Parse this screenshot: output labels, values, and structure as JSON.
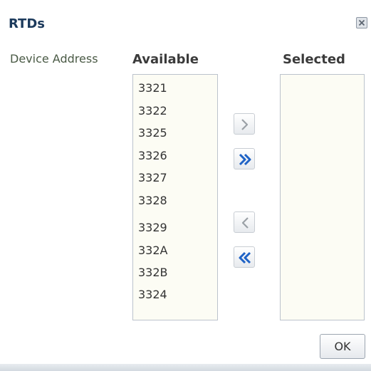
{
  "dialog": {
    "title": "RTDs",
    "close_icon": "close-icon",
    "field_label": "Device Address",
    "ok_label": "OK"
  },
  "available": {
    "header": "Available",
    "items": [
      "3321",
      "3322",
      "3325",
      "3326",
      "3327",
      "3328",
      "3329",
      "332A",
      "332B",
      "3324"
    ]
  },
  "selected": {
    "header": "Selected",
    "items": []
  },
  "shuttle": {
    "move_icon": "chevron-right-icon",
    "move_all_icon": "double-chevron-right-icon",
    "remove_icon": "chevron-left-icon",
    "remove_all_icon": "double-chevron-left-icon"
  },
  "colors": {
    "title": "#1c3a5c",
    "active_arrow": "#1f63c6",
    "disabled_arrow": "#9aa0a6",
    "list_background": "#fcfcf4"
  }
}
